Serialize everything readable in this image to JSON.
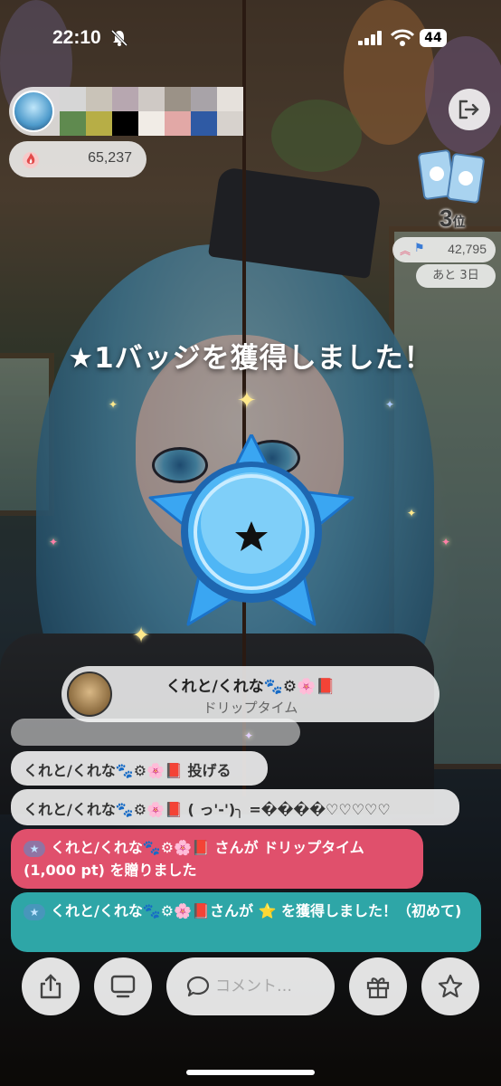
{
  "status_bar": {
    "time": "22:10",
    "battery": "44"
  },
  "streamer": {
    "pixel_colors": [
      "#d6d6d6",
      "#c9c3b8",
      "#b7a7b0",
      "#cfc9c5",
      "#9b9287",
      "#a8a3a8",
      "#e6e1dc",
      "#5f8a4f",
      "#b7ae46",
      "#000000",
      "#f1ece6",
      "#e2a8a6",
      "#2f5aa4",
      "#d7d2cd"
    ]
  },
  "points": {
    "value": "65,237"
  },
  "ranking": {
    "rank_number": "3",
    "rank_suffix": "位",
    "score": "42,795",
    "remaining": "あと 3日"
  },
  "badge": {
    "title": "★1バッジを獲得しました！"
  },
  "gift": {
    "user": "くれと/くれな🐾⚙🌸📕",
    "item": "ドリップタイム"
  },
  "comments": [
    {
      "text": "くれと/くれな🐾⚙🌸📕 投げる",
      "style": "light"
    },
    {
      "text": "くれと/くれな🐾⚙🌸📕 ( っ'-')╮ =����♡♡♡♡♡",
      "style": "light"
    },
    {
      "text": "くれと/くれな🐾⚙🌸📕 さんが ドリップタイム (1,000 pt) を贈りました",
      "style": "red",
      "star": "★"
    },
    {
      "text": "くれと/くれな🐾⚙🌸📕さんが ⭐ を獲得しました！（初めて)",
      "style": "teal",
      "star": "★"
    }
  ],
  "composer": {
    "placeholder": "コメント…"
  },
  "colors": {
    "badge_blue": "#3aa6f2",
    "gift_red": "#e0506c",
    "badge_teal": "#2ea6a7"
  },
  "icons": [
    "bell-slash-icon",
    "signal-icon",
    "wifi-icon",
    "battery-icon",
    "exit-icon",
    "flame-icon",
    "cards-icon",
    "share-icon",
    "screen-icon",
    "chat-icon",
    "gift-icon",
    "star-icon"
  ]
}
